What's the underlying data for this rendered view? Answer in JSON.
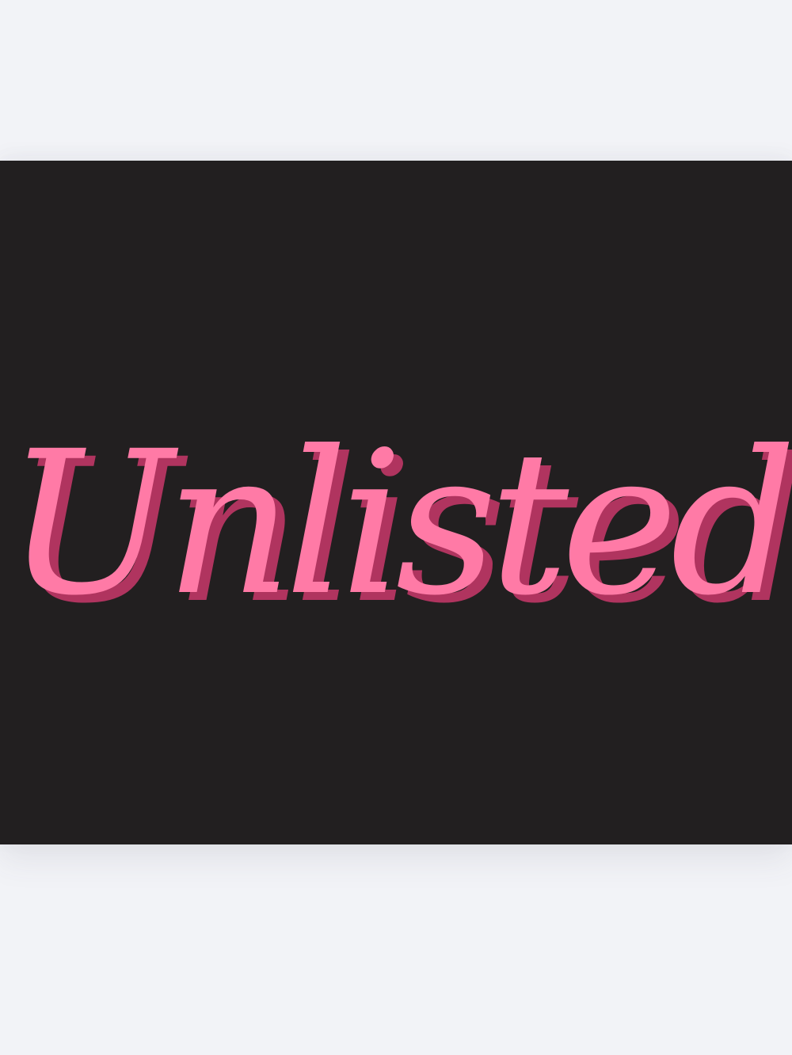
{
  "logo": {
    "wordmark": "Unlisted",
    "colors": {
      "fill": "#ff7aa6",
      "shadow": "#b0345f",
      "background": "#221f20",
      "page": "#f2f3f7"
    }
  }
}
